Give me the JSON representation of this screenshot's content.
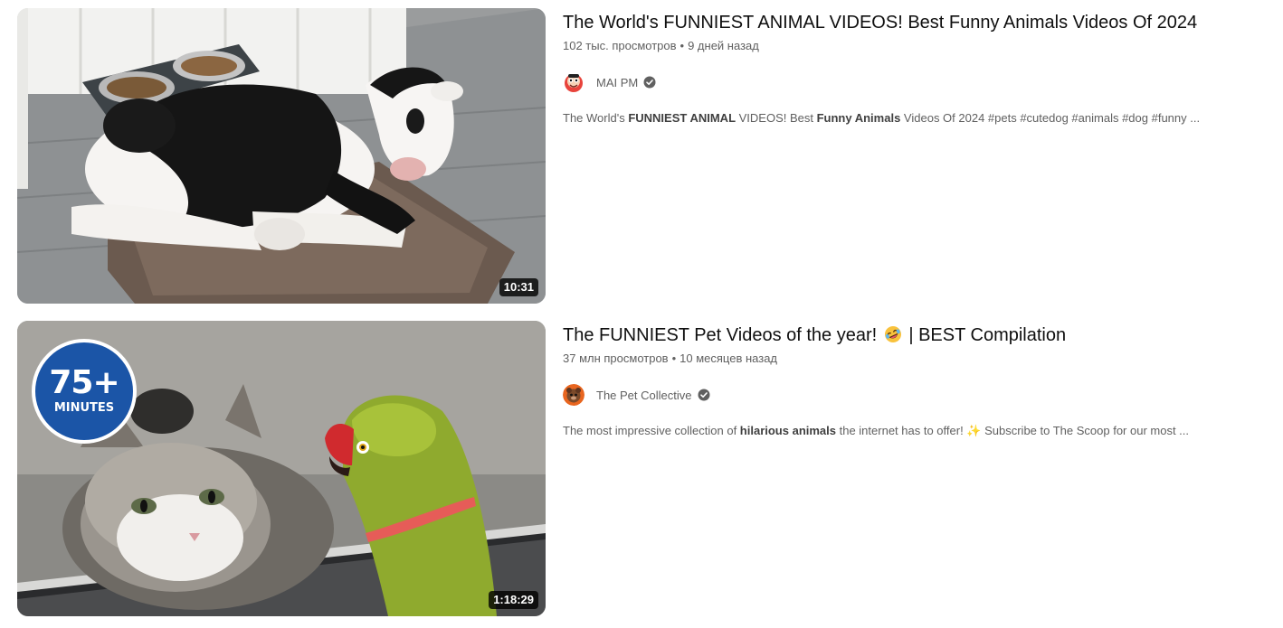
{
  "videos": [
    {
      "duration": "10:31",
      "title": "The World's FUNNIEST ANIMAL VIDEOS! Best Funny Animals Videos Of 2024",
      "views": "102 тыс. просмотров",
      "age": "9 дней назад",
      "channel": "MAI PM",
      "verified": true,
      "description_parts": {
        "p1": "The World's ",
        "b1": "FUNNIEST ANIMAL",
        "p2": " VIDEOS! Best ",
        "b2": "Funny Animals",
        "p3": " Videos Of 2024 #pets #cutedog #animals #dog #funny ..."
      }
    },
    {
      "duration": "1:18:29",
      "badge_big": "75+",
      "badge_small": "MINUTES",
      "title_part1": "The FUNNIEST Pet Videos of the year!",
      "title_part2": "| BEST Compilation",
      "views": "37 млн просмотров",
      "age": "10 месяцев назад",
      "channel": "The Pet Collective",
      "verified": true,
      "description_parts": {
        "p1": "The most impressive collection of ",
        "b1": "hilarious animals",
        "p2": " the internet has to offer! ✨ Subscribe to The Scoop for our most ..."
      }
    }
  ],
  "icons": {
    "verified": "verified-check-icon",
    "emoji": "rolling-laughing-emoji-icon"
  },
  "colors": {
    "title": "#0f0f0f",
    "meta": "#606060",
    "badge_blue": "#1b55a7"
  }
}
